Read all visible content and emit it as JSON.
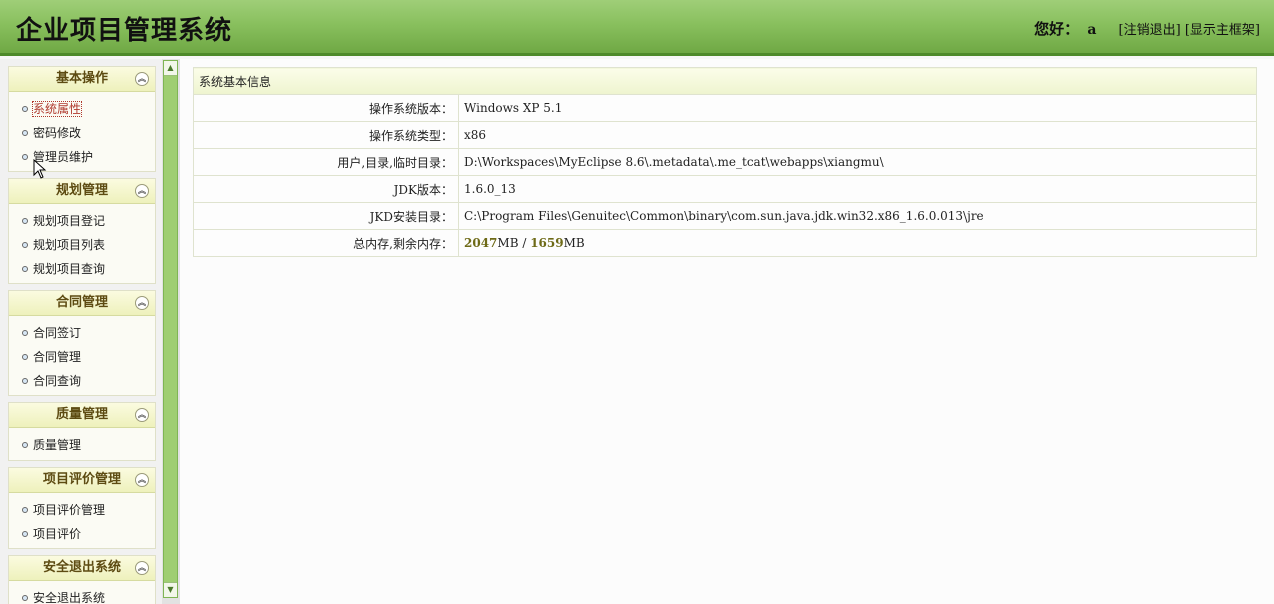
{
  "header": {
    "title": "企业项目管理系统",
    "greeting": "您好：",
    "username": "a",
    "logout_link": "[注销退出]",
    "show_frame_link": "[显示主框架]"
  },
  "sidebar": {
    "panels": [
      {
        "title": "基本操作",
        "items": [
          "系统属性",
          "密码修改",
          "管理员维护"
        ]
      },
      {
        "title": "规划管理",
        "items": [
          "规划项目登记",
          "规划项目列表",
          "规划项目查询"
        ]
      },
      {
        "title": "合同管理",
        "items": [
          "合同签订",
          "合同管理",
          "合同查询"
        ]
      },
      {
        "title": "质量管理",
        "items": [
          "质量管理"
        ]
      },
      {
        "title": "项目评价管理",
        "items": [
          "项目评价管理",
          "项目评价"
        ]
      },
      {
        "title": "安全退出系统",
        "items": [
          "安全退出系统"
        ]
      }
    ],
    "active_item": "系统属性"
  },
  "main": {
    "table_title": "系统基本信息",
    "rows": [
      {
        "label": "操作系统版本：",
        "value": "Windows XP  5.1"
      },
      {
        "label": "操作系统类型：",
        "value": "x86"
      },
      {
        "label": "用户,目录,临时目录：",
        "value": "D:\\Workspaces\\MyEclipse 8.6\\.metadata\\.me_tcat\\webapps\\xiangmu\\"
      },
      {
        "label": "JDK版本：",
        "value": "1.6.0_13"
      },
      {
        "label": "JKD安装目录：",
        "value": "C:\\Program Files\\Genuitec\\Common\\binary\\com.sun.java.jdk.win32.x86_1.6.0.013\\jre"
      }
    ],
    "memory": {
      "label": "总内存,剩余内存：",
      "total": "2047",
      "total_unit": "MB",
      "separator": " / ",
      "free": "1659",
      "free_unit": "MB"
    }
  },
  "icons": {
    "collapse": "chevron-up-double-icon",
    "bullet": "bullet-icon",
    "cursor": "mouse-cursor-icon"
  }
}
